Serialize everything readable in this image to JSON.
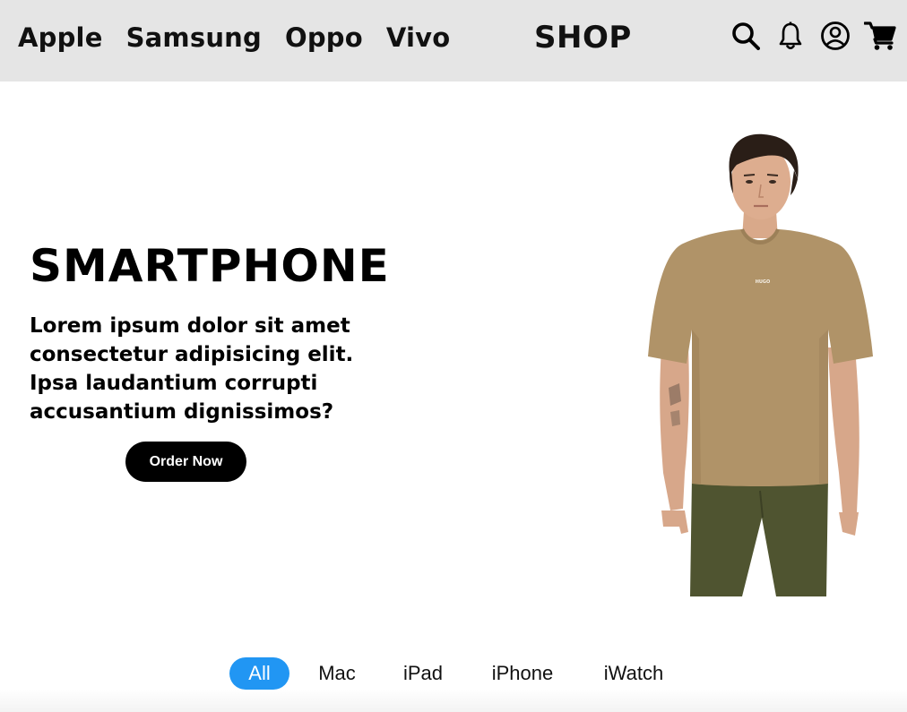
{
  "header": {
    "nav": [
      "Apple",
      "Samsung",
      "Oppo",
      "Vivo"
    ],
    "logo": "SHOP",
    "icons": [
      "search-icon",
      "bell-icon",
      "user-circle-icon",
      "cart-icon"
    ]
  },
  "hero": {
    "title": "SMARTPHONE",
    "description": "Lorem ipsum dolor sit amet consectetur adipisicing elit. Ipsa laudantium corrupti accusantium dignissimos?",
    "cta": "Order Now",
    "shirt_print": "HUGO"
  },
  "filters": {
    "tabs": [
      "All",
      "Mac",
      "iPad",
      "iPhone",
      "iWatch"
    ],
    "active": "All",
    "active_color": "#2196f3"
  },
  "colors": {
    "header_bg": "#e5e5e5",
    "button_bg": "#000000",
    "shirt": "#b09368",
    "trousers": "#4f5430"
  }
}
